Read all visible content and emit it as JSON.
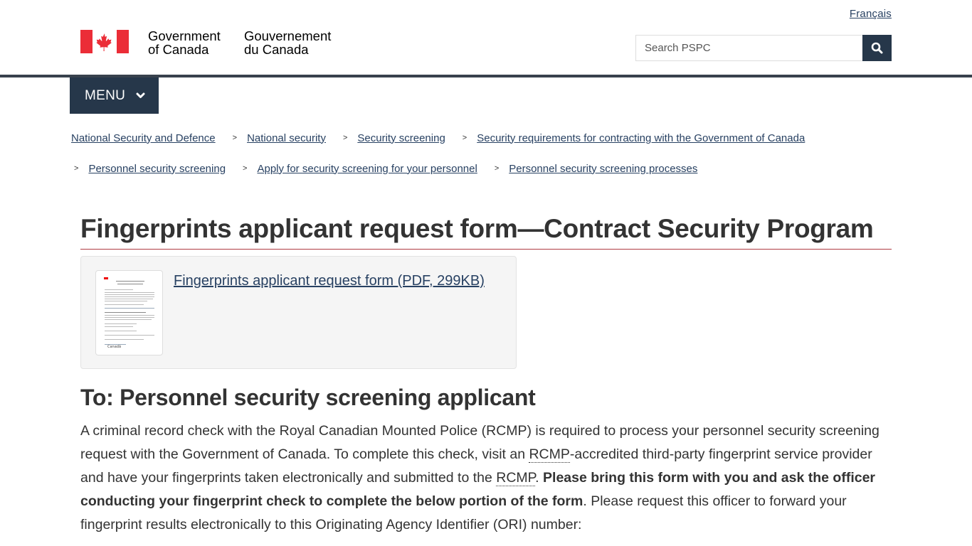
{
  "header": {
    "language_toggle": "Français",
    "wordmark_en_line1": "Government",
    "wordmark_en_line2": "of Canada",
    "wordmark_fr_line1": "Gouvernement",
    "wordmark_fr_line2": "du Canada",
    "search_placeholder": "Search PSPC",
    "search_value": "",
    "search_icon": "search-icon",
    "flag_icon": "canada-flag-icon",
    "colors": {
      "nav_dark": "#26374a",
      "flag_red": "#eb2d37",
      "link": "#284162",
      "title_rule": "#af3c43"
    }
  },
  "menu": {
    "label": "MENU",
    "icon": "chevron-down-icon"
  },
  "breadcrumb": {
    "separator": ">",
    "row1": [
      "National Security and Defence",
      "National security",
      "Security screening",
      "Security requirements for contracting with the Government of Canada"
    ],
    "row2": [
      "Personnel security screening",
      "Apply for security screening for your personnel",
      "Personnel security screening processes"
    ]
  },
  "main": {
    "title": "Fingerprints applicant request form—Contract Security Program",
    "download": {
      "link_text": "Fingerprints applicant request form (PDF,  299KB)",
      "thumbnail": "pdf-thumbnail-image"
    },
    "section_heading": "To: Personnel security screening applicant",
    "paragraph": {
      "p1": "A criminal record check with the Royal Canadian Mounted Police (RCMP) is required to process your personnel security screening request with the Government of Canada. To complete this check, visit an ",
      "abbr1": "RCMP",
      "p2": "-accredited third-party fingerprint service provider and have your fingerprints taken electronically and submitted to the ",
      "abbr2": "RCMP",
      "p3": ". ",
      "bold": "Please bring this form with you and ask the officer conducting your fingerprint check to complete the below portion of the form",
      "p4": ". Please request this officer to forward your fingerprint results electronically to this Originating Agency Identifier (ORI) number:"
    }
  }
}
